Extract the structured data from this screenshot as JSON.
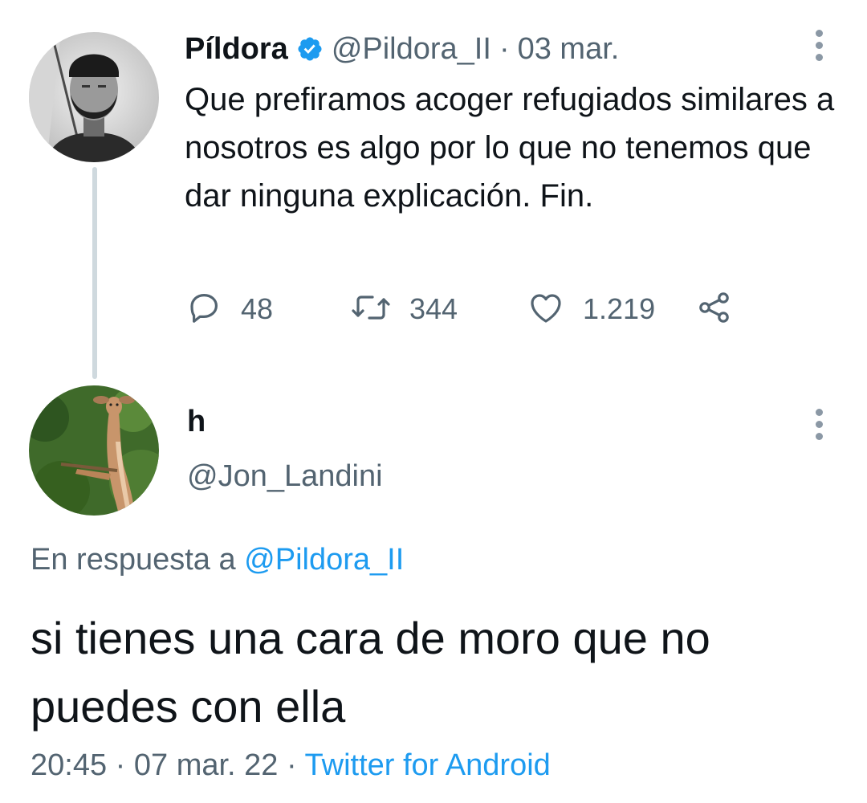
{
  "parent_tweet": {
    "display_name": "Píldora",
    "handle": "@Pildora_II",
    "separator": "·",
    "date": "03 mar.",
    "text": "Que prefiramos acoger refugiados similares a nosotros es algo por lo que no tenemos que dar ninguna explicación. Fin.",
    "verified": true,
    "stats": {
      "replies": "48",
      "retweets": "344",
      "likes": "1.219"
    }
  },
  "reply_tweet": {
    "display_name": "h",
    "handle": "@Jon_Landini",
    "replying_prefix": "En respuesta a",
    "replying_to": "@Pildora_II",
    "text": "si tienes una cara de moro que no puedes con ella",
    "time": "20:45",
    "separator": "·",
    "date": "07 mar. 22",
    "source": "Twitter for Android"
  },
  "colors": {
    "text": "#0f1419",
    "secondary": "#536471",
    "link": "#1d9bf0",
    "thread_line": "#cfd9de"
  },
  "icons": {
    "reply": "reply-icon",
    "retweet": "retweet-icon",
    "like": "heart-icon",
    "share": "share-icon",
    "more": "more-options-icon",
    "verified": "verified-badge-icon"
  }
}
